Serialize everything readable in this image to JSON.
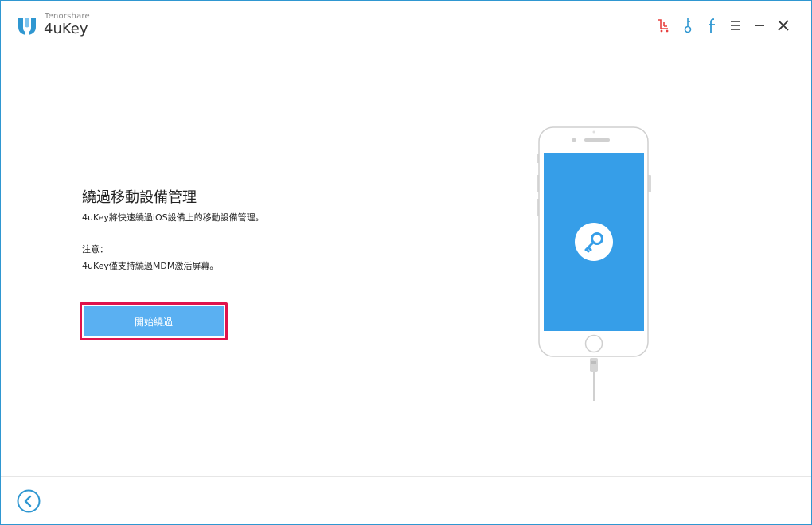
{
  "app": {
    "brand_top": "Tenorshare",
    "brand_name": "4uKey"
  },
  "titlebar": {
    "icons": [
      "cart-icon",
      "key-icon",
      "facebook-icon",
      "menu-icon",
      "minimize-icon",
      "close-icon"
    ]
  },
  "main": {
    "title": "繞過移動設備管理",
    "description": "4uKey將快速繞過iOS設備上的移動設備管理。",
    "note_label": "注意：",
    "note_text": "4uKey僅支持繞過MDM激活屏幕。",
    "start_button_label": "開始繞過"
  },
  "colors": {
    "accent": "#2f97d1",
    "button": "#5ab0f2",
    "highlight": "#e0124c",
    "phone_screen": "#369ee8",
    "cart_icon": "#e8403f"
  }
}
